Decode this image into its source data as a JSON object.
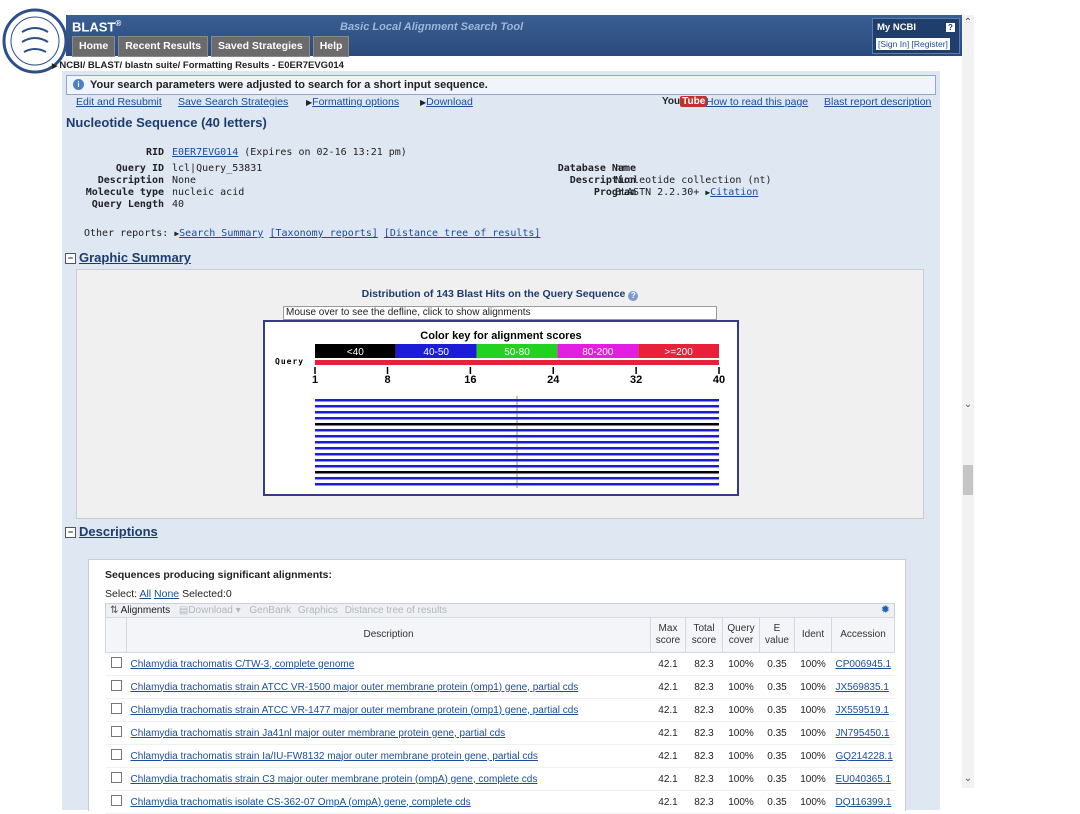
{
  "header": {
    "brand": "BLAST",
    "brand_mark": "®",
    "tagline": "Basic Local Alignment Search Tool",
    "tabs": [
      "Home",
      "Recent Results",
      "Saved Strategies",
      "Help"
    ],
    "myncbi_title": "My NCBI",
    "myncbi_help": "?",
    "myncbi_links": "[Sign In] [Register]"
  },
  "breadcrumb": "NCBI/ BLAST/ blastn suite/ Formatting Results - E0ER7EVG014",
  "notice": "Your search parameters were adjusted to search for a short input sequence.",
  "actions": {
    "edit": "Edit and Resubmit",
    "save": "Save Search Strategies",
    "formatting": "Formatting options",
    "download": "Download",
    "youtube_you": "You",
    "youtube_tube": "Tube",
    "howto": "How to read this page",
    "report_desc": "Blast report description"
  },
  "page_title": "Nucleotide Sequence (40 letters)",
  "query_info": {
    "rid_label": "RID",
    "rid_value": "E0ER7EVG014",
    "rid_expire": "(Expires on 02-16 13:21 pm)",
    "query_id_label": "Query ID",
    "query_id_value": "lcl|Query_53831",
    "description_label": "Description",
    "description_value": "None",
    "molecule_label": "Molecule type",
    "molecule_value": "nucleic acid",
    "length_label": "Query Length",
    "length_value": "40",
    "db_label": "Database Name",
    "db_value": "nr",
    "db_desc_label": "Description",
    "db_desc_value": "Nucleotide collection (nt)",
    "program_label": "Program",
    "program_value": "BLASTN 2.2.30+",
    "citation": "Citation"
  },
  "other_reports": {
    "label": "Other reports:",
    "search_summary": "Search Summary",
    "taxonomy": "[Taxonomy reports]",
    "distance": "[Distance tree of results]"
  },
  "graphic_summary": {
    "heading": "Graphic Summary",
    "toggle": "−",
    "title": "Distribution of 143 Blast Hits on the Query Sequence",
    "help": "?",
    "mouseover": "Mouse over to see the defline, click to show alignments",
    "color_key_title": "Color key for alignment scores",
    "key_labels": [
      "<40",
      "40-50",
      "50-80",
      "80-200",
      ">=200"
    ],
    "key_colors": [
      "#000000",
      "#1c1cd8",
      "#21d321",
      "#e21ee2",
      "#e8203a"
    ],
    "query_label": "Query",
    "ticks": [
      "1",
      "8",
      "16",
      "24",
      "32",
      "40"
    ],
    "hit_count_drawn": 15,
    "black_hits": [
      4,
      12
    ]
  },
  "descriptions": {
    "heading": "Descriptions",
    "toggle": "−",
    "subheading": "Sequences producing significant alignments:",
    "select_label": "Select:",
    "select_all": "All",
    "select_none": "None",
    "selected": "Selected:0",
    "toolbar_alignments": "Alignments",
    "toolbar_download": "Download",
    "toolbar_genbank": "GenBank",
    "toolbar_graphics": "Graphics",
    "toolbar_distance": "Distance tree of results",
    "columns": {
      "description": "Description",
      "max_score": [
        "Max",
        "score"
      ],
      "total_score": [
        "Total",
        "score"
      ],
      "query_cover": [
        "Query",
        "cover"
      ],
      "e_value": [
        "E",
        "value"
      ],
      "ident": "Ident",
      "accession": "Accession"
    },
    "rows": [
      {
        "description": "Chlamydia trachomatis C/TW-3, complete genome",
        "max": "42.1",
        "total": "82.3",
        "cover": "100%",
        "e": "0.35",
        "ident": "100%",
        "acc": "CP006945.1"
      },
      {
        "description": "Chlamydia trachomatis strain ATCC VR-1500 major outer membrane protein (omp1) gene, partial cds",
        "max": "42.1",
        "total": "82.3",
        "cover": "100%",
        "e": "0.35",
        "ident": "100%",
        "acc": "JX569835.1"
      },
      {
        "description": "Chlamydia trachomatis strain ATCC VR-1477 major outer membrane protein (omp1) gene, partial cds",
        "max": "42.1",
        "total": "82.3",
        "cover": "100%",
        "e": "0.35",
        "ident": "100%",
        "acc": "JX559519.1"
      },
      {
        "description": "Chlamydia trachomatis strain Ja41nl major outer membrane protein gene, partial cds",
        "max": "42.1",
        "total": "82.3",
        "cover": "100%",
        "e": "0.35",
        "ident": "100%",
        "acc": "JN795450.1"
      },
      {
        "description": "Chlamydia trachomatis strain Ia/IU-FW8132 major outer membrane protein gene, partial cds",
        "max": "42.1",
        "total": "82.3",
        "cover": "100%",
        "e": "0.35",
        "ident": "100%",
        "acc": "GQ214228.1"
      },
      {
        "description": "Chlamydia trachomatis strain C3 major outer membrane protein (ompA) gene, complete cds",
        "max": "42.1",
        "total": "82.3",
        "cover": "100%",
        "e": "0.35",
        "ident": "100%",
        "acc": "EU040365.1"
      },
      {
        "description": "Chlamydia trachomatis isolate CS-362-07 OmpA (ompA) gene, complete cds",
        "max": "42.1",
        "total": "82.3",
        "cover": "100%",
        "e": "0.35",
        "ident": "100%",
        "acc": "DQ116399.1"
      }
    ]
  }
}
